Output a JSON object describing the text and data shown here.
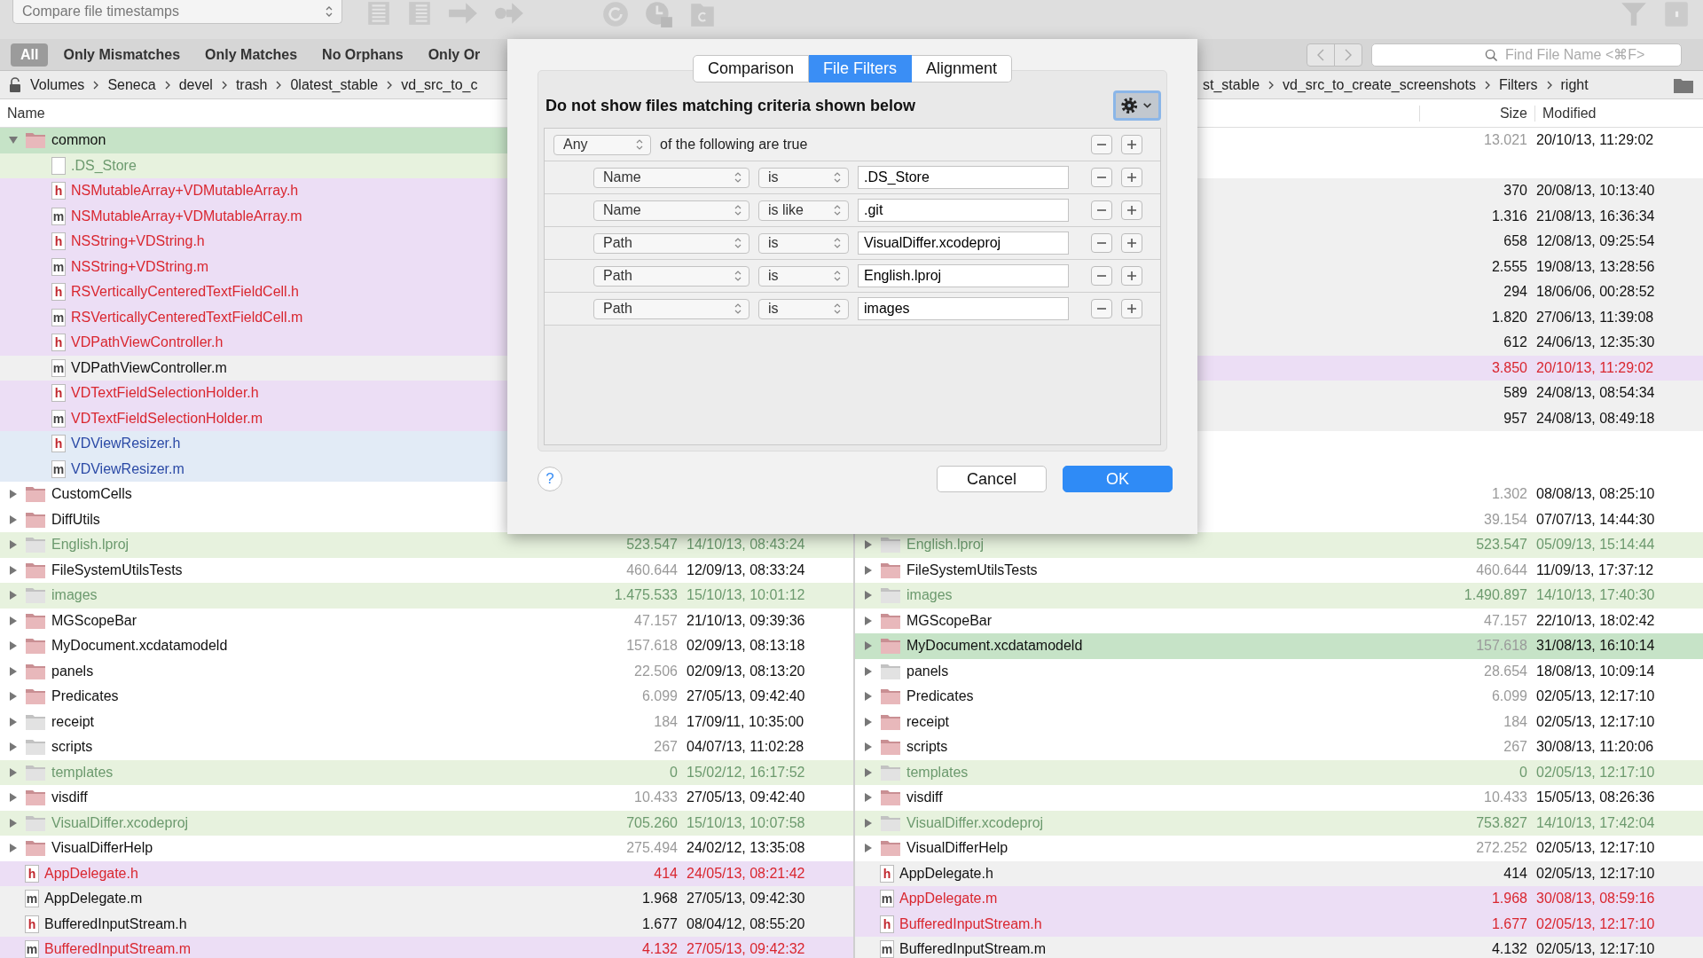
{
  "toolbar": {
    "comparison_mode": "Compare file timestamps"
  },
  "scope_bar": [
    {
      "label": "All",
      "selected": true
    },
    {
      "label": "Only Mismatches",
      "selected": false
    },
    {
      "label": "Only Matches",
      "selected": false
    },
    {
      "label": "No Orphans",
      "selected": false
    },
    {
      "label": "Only Or",
      "selected": false
    }
  ],
  "search": {
    "placeholder": "Find File Name <⌘F>"
  },
  "left_pane": {
    "path": [
      "Volumes",
      "Seneca",
      "devel",
      "trash",
      "0latest_stable",
      "vd_src_to_c"
    ],
    "columns": [
      {
        "label": "Name",
        "kind": "name"
      }
    ],
    "rows": [
      {
        "name": "common",
        "folder": true,
        "changed": true,
        "expanded": true,
        "kind": "plain",
        "selected": true,
        "children": [
          {
            "name": ".DS_Store",
            "folder": false,
            "kind": "filtered",
            "selected": false
          },
          {
            "name": "NSMutableArray+VDMutableArray.h",
            "folder": false,
            "badge": "h",
            "kind": "mismatch",
            "selected": false
          },
          {
            "name": "NSMutableArray+VDMutableArray.m",
            "folder": false,
            "badge": "m",
            "kind": "mismatch",
            "selected": false
          },
          {
            "name": "NSString+VDString.h",
            "folder": false,
            "badge": "h",
            "kind": "mismatch",
            "selected": false
          },
          {
            "name": "NSString+VDString.m",
            "folder": false,
            "badge": "m",
            "kind": "mismatch",
            "selected": false
          },
          {
            "name": "RSVerticallyCenteredTextFieldCell.h",
            "folder": false,
            "badge": "h",
            "kind": "mismatch",
            "selected": false
          },
          {
            "name": "RSVerticallyCenteredTextFieldCell.m",
            "folder": false,
            "badge": "m",
            "kind": "mismatch",
            "selected": false
          },
          {
            "name": "VDPathViewController.h",
            "folder": false,
            "badge": "h",
            "kind": "mismatch",
            "selected": false
          },
          {
            "name": "VDPathViewController.m",
            "folder": false,
            "badge": "m",
            "kind": "match",
            "selected": false
          },
          {
            "name": "VDTextFieldSelectionHolder.h",
            "folder": false,
            "badge": "h",
            "kind": "mismatch",
            "selected": false
          },
          {
            "name": "VDTextFieldSelectionHolder.m",
            "folder": false,
            "badge": "m",
            "kind": "mismatch",
            "selected": false
          },
          {
            "name": "VDViewResizer.h",
            "folder": false,
            "badge": "h",
            "kind": "newer",
            "selected": false
          },
          {
            "name": "VDViewResizer.m",
            "folder": false,
            "badge": "m",
            "kind": "newer",
            "selected": false
          }
        ]
      },
      {
        "name": "CustomCells",
        "folder": true,
        "changed": true,
        "expanded": false,
        "kind": "plain",
        "selected": false
      },
      {
        "name": "DiffUtils",
        "folder": true,
        "changed": true,
        "expanded": false,
        "kind": "plain",
        "selected": false
      },
      {
        "name": "English.lproj",
        "folder": true,
        "changed": false,
        "expanded": false,
        "kind": "filtered",
        "selected": false,
        "size": "523.547",
        "modified": "14/10/13, 08:43:24"
      },
      {
        "name": "FileSystemUtilsTests",
        "folder": true,
        "changed": true,
        "expanded": false,
        "kind": "plain",
        "selected": false,
        "size": "460.644",
        "modified": "12/09/13, 08:33:24"
      },
      {
        "name": "images",
        "folder": true,
        "changed": false,
        "expanded": false,
        "kind": "filtered",
        "selected": false,
        "size": "1.475.533",
        "modified": "15/10/13, 10:01:12"
      },
      {
        "name": "MGScopeBar",
        "folder": true,
        "changed": true,
        "expanded": false,
        "kind": "plain",
        "selected": false,
        "size": "47.157",
        "modified": "21/10/13, 09:39:36"
      },
      {
        "name": "MyDocument.xcdatamodeld",
        "folder": true,
        "changed": true,
        "expanded": false,
        "kind": "plain",
        "selected": false,
        "size": "157.618",
        "modified": "02/09/13, 08:13:18"
      },
      {
        "name": "panels",
        "folder": true,
        "changed": true,
        "expanded": false,
        "kind": "plain",
        "selected": false,
        "size": "22.506",
        "modified": "02/09/13, 08:13:20"
      },
      {
        "name": "Predicates",
        "folder": true,
        "changed": true,
        "expanded": false,
        "kind": "plain",
        "selected": false,
        "size": "6.099",
        "modified": "27/05/13, 09:42:40"
      },
      {
        "name": "receipt",
        "folder": true,
        "changed": false,
        "expanded": false,
        "kind": "plain",
        "selected": false,
        "size": "184",
        "modified": "17/09/11, 10:35:00"
      },
      {
        "name": "scripts",
        "folder": true,
        "changed": false,
        "expanded": false,
        "kind": "plain",
        "selected": false,
        "size": "267",
        "modified": "04/07/13, 11:02:28"
      },
      {
        "name": "templates",
        "folder": true,
        "changed": false,
        "expanded": false,
        "kind": "filtered",
        "selected": false,
        "size": "0",
        "modified": "15/02/12, 16:17:52"
      },
      {
        "name": "visdiff",
        "folder": true,
        "changed": true,
        "expanded": false,
        "kind": "plain",
        "selected": false,
        "size": "10.433",
        "modified": "27/05/13, 09:42:40"
      },
      {
        "name": "VisualDiffer.xcodeproj",
        "folder": true,
        "changed": false,
        "expanded": false,
        "kind": "filtered",
        "selected": false,
        "size": "705.260",
        "modified": "15/10/13, 10:07:58"
      },
      {
        "name": "VisualDifferHelp",
        "folder": true,
        "changed": true,
        "expanded": false,
        "kind": "plain",
        "selected": false,
        "size": "275.494",
        "modified": "24/02/12, 13:35:08"
      },
      {
        "name": "AppDelegate.h",
        "folder": false,
        "badge": "h",
        "kind": "mismatch",
        "selected": false,
        "size": "414",
        "modified": "24/05/13, 08:21:42"
      },
      {
        "name": "AppDelegate.m",
        "folder": false,
        "badge": "m",
        "kind": "match",
        "selected": false,
        "size": "1.968",
        "modified": "27/05/13, 09:42:30"
      },
      {
        "name": "BufferedInputStream.h",
        "folder": false,
        "badge": "h",
        "kind": "match",
        "selected": false,
        "size": "1.677",
        "modified": "08/04/12, 08:55:20"
      },
      {
        "name": "BufferedInputStream.m",
        "folder": false,
        "badge": "m",
        "kind": "mismatch",
        "selected": false,
        "size": "4.132",
        "modified": "27/05/13, 09:42:32"
      }
    ]
  },
  "right_pane": {
    "path": [
      "st_stable",
      "vd_src_to_create_screenshots",
      "Filters",
      "right"
    ],
    "columns": [
      {
        "label": "Size",
        "kind": "size"
      },
      {
        "label": "Modified",
        "kind": "date"
      }
    ],
    "rows": [
      {
        "folder": true,
        "kind": "plain",
        "selected": false,
        "size": "13.021",
        "modified": "20/10/13, 11:29:02",
        "children": [
          {
            "kind": "plain",
            "selected": false
          },
          {
            "folder": false,
            "kind": "match",
            "selected": false,
            "size": "370",
            "modified": "20/08/13, 10:13:40"
          },
          {
            "folder": false,
            "kind": "match",
            "selected": false,
            "size": "1.316",
            "modified": "21/08/13, 16:36:34"
          },
          {
            "folder": false,
            "kind": "match",
            "selected": false,
            "size": "658",
            "modified": "12/08/13, 09:25:54"
          },
          {
            "folder": false,
            "kind": "match",
            "selected": false,
            "size": "2.555",
            "modified": "19/08/13, 13:28:56"
          },
          {
            "folder": false,
            "kind": "match",
            "selected": false,
            "size": "294",
            "modified": "18/06/06, 00:28:52"
          },
          {
            "folder": false,
            "kind": "match",
            "selected": false,
            "size": "1.820",
            "modified": "27/06/13, 11:39:08"
          },
          {
            "folder": false,
            "kind": "match",
            "selected": false,
            "size": "612",
            "modified": "24/06/13, 12:35:30"
          },
          {
            "folder": false,
            "kind": "mismatch",
            "selected": false,
            "size": "3.850",
            "modified": "20/10/13, 11:29:02"
          },
          {
            "folder": false,
            "kind": "match",
            "selected": false,
            "size": "589",
            "modified": "24/08/13, 08:54:34"
          },
          {
            "folder": false,
            "kind": "match",
            "selected": false,
            "size": "957",
            "modified": "24/08/13, 08:49:18"
          },
          {
            "kind": "plain",
            "selected": false
          },
          {
            "kind": "plain",
            "selected": false
          }
        ]
      },
      {
        "folder": true,
        "kind": "plain",
        "selected": false,
        "size": "1.302",
        "modified": "08/08/13, 08:25:10"
      },
      {
        "folder": true,
        "kind": "plain",
        "selected": false,
        "size": "39.154",
        "modified": "07/07/13, 14:44:30"
      },
      {
        "name": "English.lproj",
        "folder": true,
        "changed": false,
        "expanded": false,
        "kind": "filtered",
        "selected": false,
        "size": "523.547",
        "modified": "05/09/13, 15:14:44"
      },
      {
        "name": "FileSystemUtilsTests",
        "folder": true,
        "changed": true,
        "expanded": false,
        "kind": "plain",
        "selected": false,
        "size": "460.644",
        "modified": "11/09/13, 17:37:12"
      },
      {
        "name": "images",
        "folder": true,
        "changed": false,
        "expanded": false,
        "kind": "filtered",
        "selected": false,
        "size": "1.490.897",
        "modified": "14/10/13, 17:40:30"
      },
      {
        "name": "MGScopeBar",
        "folder": true,
        "changed": true,
        "expanded": false,
        "kind": "plain",
        "selected": false,
        "size": "47.157",
        "modified": "22/10/13, 18:02:42"
      },
      {
        "name": "MyDocument.xcdatamodeld",
        "folder": true,
        "changed": true,
        "expanded": false,
        "kind": "plain",
        "selected": true,
        "size": "157.618",
        "modified": "31/08/13, 16:10:14"
      },
      {
        "name": "panels",
        "folder": true,
        "changed": false,
        "expanded": false,
        "kind": "plain",
        "selected": false,
        "size": "28.654",
        "modified": "18/08/13, 10:09:14"
      },
      {
        "name": "Predicates",
        "folder": true,
        "changed": true,
        "expanded": false,
        "kind": "plain",
        "selected": false,
        "size": "6.099",
        "modified": "02/05/13, 12:17:10"
      },
      {
        "name": "receipt",
        "folder": true,
        "changed": true,
        "expanded": false,
        "kind": "plain",
        "selected": false,
        "size": "184",
        "modified": "02/05/13, 12:17:10"
      },
      {
        "name": "scripts",
        "folder": true,
        "changed": true,
        "expanded": false,
        "kind": "plain",
        "selected": false,
        "size": "267",
        "modified": "30/08/13, 11:20:06"
      },
      {
        "name": "templates",
        "folder": true,
        "changed": false,
        "expanded": false,
        "kind": "filtered",
        "selected": false,
        "size": "0",
        "modified": "02/05/13, 12:17:10"
      },
      {
        "name": "visdiff",
        "folder": true,
        "changed": true,
        "expanded": false,
        "kind": "plain",
        "selected": false,
        "size": "10.433",
        "modified": "15/05/13, 08:26:36"
      },
      {
        "name": "VisualDiffer.xcodeproj",
        "folder": true,
        "changed": false,
        "expanded": false,
        "kind": "filtered",
        "selected": false,
        "size": "753.827",
        "modified": "14/10/13, 17:42:04"
      },
      {
        "name": "VisualDifferHelp",
        "folder": true,
        "changed": true,
        "expanded": false,
        "kind": "plain",
        "selected": false,
        "size": "272.252",
        "modified": "02/05/13, 12:17:10"
      },
      {
        "name": "AppDelegate.h",
        "folder": false,
        "badge": "h",
        "kind": "match",
        "selected": false,
        "size": "414",
        "modified": "02/05/13, 12:17:10"
      },
      {
        "name": "AppDelegate.m",
        "folder": false,
        "badge": "m",
        "kind": "mismatch",
        "selected": false,
        "size": "1.968",
        "modified": "30/08/13, 08:59:16"
      },
      {
        "name": "BufferedInputStream.h",
        "folder": false,
        "badge": "h",
        "kind": "mismatch",
        "selected": false,
        "size": "1.677",
        "modified": "02/05/13, 12:17:10"
      },
      {
        "name": "BufferedInputStream.m",
        "folder": false,
        "badge": "m",
        "kind": "match",
        "selected": false,
        "size": "4.132",
        "modified": "02/05/13, 12:17:10"
      }
    ]
  },
  "dialog": {
    "tabs": [
      {
        "label": "Comparison",
        "selected": false
      },
      {
        "label": "File Filters",
        "selected": true
      },
      {
        "label": "Alignment",
        "selected": false
      }
    ],
    "heading": "Do not show files matching criteria shown below",
    "match": {
      "quantifier": "Any",
      "suffix": "of the following are true"
    },
    "rules": [
      {
        "field": "Name",
        "operator": "is",
        "value": ".DS_Store"
      },
      {
        "field": "Name",
        "operator": "is like",
        "value": ".git"
      },
      {
        "field": "Path",
        "operator": "is",
        "value": "VisualDiffer.xcodeproj"
      },
      {
        "field": "Path",
        "operator": "is",
        "value": "English.lproj"
      },
      {
        "field": "Path",
        "operator": "is",
        "value": "images"
      }
    ],
    "help": "?",
    "buttons": [
      {
        "label": "Cancel",
        "kind": "cancel"
      },
      {
        "label": "OK",
        "kind": "default"
      }
    ]
  }
}
